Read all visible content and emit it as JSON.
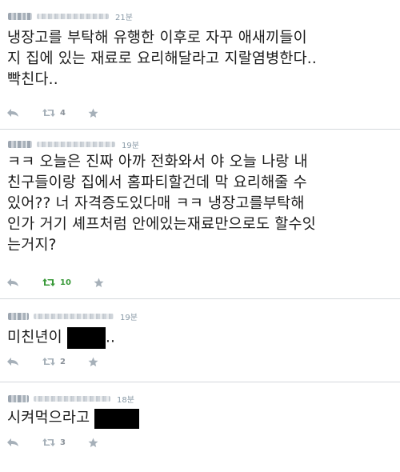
{
  "tweets": [
    {
      "time": "21분",
      "text": "냉장고를 부탁해 유행한 이후로 자꾸 애새끼들이\n지 집에 있는 재료로 요리해달라고 지랄염병한다..\n빡친다..",
      "retweet_count": "4",
      "retweeted": false
    },
    {
      "time": "19분",
      "text": "ㅋㅋ 오늘은 진짜 아까 전화와서 야 오늘 나랑 내\n친구들이랑 집에서 홈파티할건데 막 요리해줄 수\n있어?? 너 자격증도있다매 ㅋㅋ 냉장고를부탁해\n인가 거기 셰프처럼 안에있는재료만으로도 할수잇\n는거지?",
      "retweet_count": "10",
      "retweeted": true
    },
    {
      "time": "19분",
      "text_before": "미친년이 ",
      "text_after": "..",
      "retweet_count": "2",
      "retweeted": false
    },
    {
      "time": "18분",
      "text_before": "시켜먹으라고 ",
      "text_after": "",
      "retweet_count": "3",
      "retweeted": false
    }
  ],
  "colors": {
    "icon": "#a6b0b9",
    "retweet_active": "#3a9a3a",
    "divider": "#d4d8dc",
    "redaction": "#000000"
  },
  "icons": [
    "reply-icon",
    "retweet-icon",
    "favorite-icon"
  ]
}
